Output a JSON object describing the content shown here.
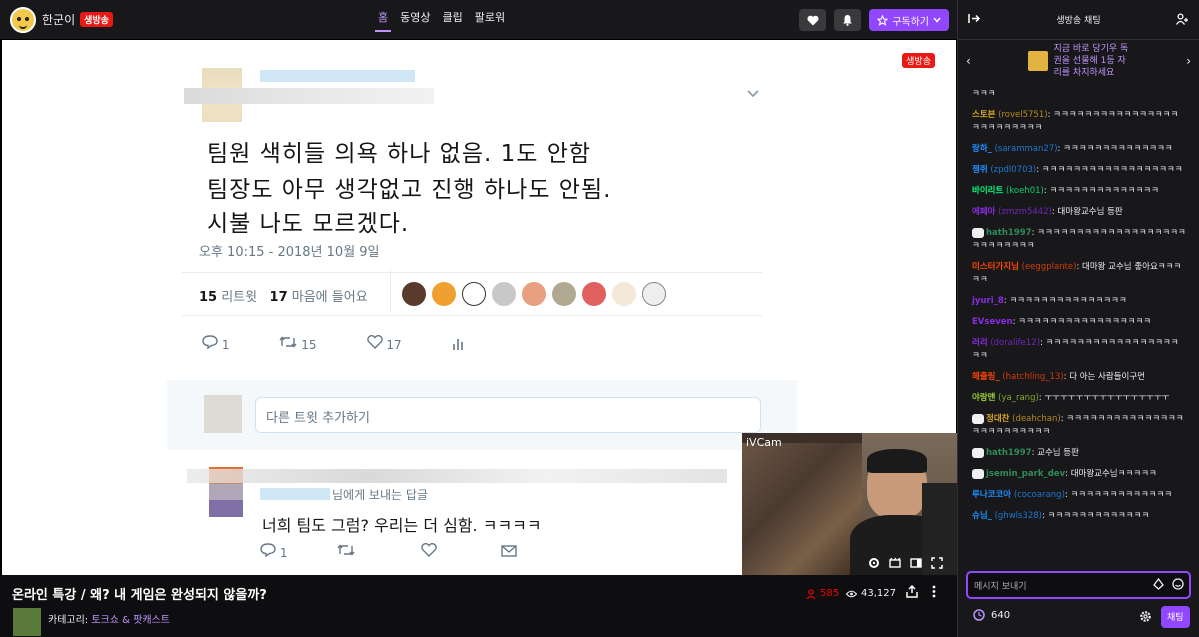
{
  "channel": {
    "name": "한군이",
    "live_label": "생방송"
  },
  "nav": {
    "tabs": [
      {
        "label": "홈",
        "active": true
      },
      {
        "label": "동영상",
        "active": false
      },
      {
        "label": "클립",
        "active": false
      },
      {
        "label": "팔로워",
        "active": false
      }
    ],
    "subscribe_label": "구독하기"
  },
  "video": {
    "live_label": "생방송",
    "tweet": {
      "line1": "팀원 색히들 의욕 하나 없음. 1도 안함",
      "line2": "팀장도 아무 생각없고 진행 하나도 안됨.",
      "line3": "시불 나도 모르겠다.",
      "date": "오후 10:15 - 2018년 10월 9일",
      "retweets_count": "15",
      "retweets_label": "리트윗",
      "likes_count": "17",
      "likes_label": "마음에 들어요",
      "reply_count": "1",
      "retweet_action_count": "15",
      "like_action_count": "17",
      "add_tweet_placeholder": "다른 트윗 추가하기",
      "reply_to_label": "님에게 보내는 답글",
      "reply_text": "너희 팀도 그럼? 우리는 더 심함. ㅋㅋㅋㅋ",
      "reply_reply_count": "1"
    },
    "cam_label": "iVCam"
  },
  "info": {
    "title": "온라인 특강 / 왜? 내 게임은 완성되지 않을까?",
    "category_prefix": "카테고리:",
    "category": "토크쇼 & 팟캐스트",
    "viewers": "585",
    "views": "43,127"
  },
  "chat": {
    "header": "생방송 채팅",
    "gift_text": "지금 바로 당기우 독권을 선물해 1등 자리를 차지하세요",
    "messages": [
      {
        "name": "",
        "id": "",
        "text": "ㅋㅋㅋ",
        "color": "#efeff1"
      },
      {
        "name": "스토븐",
        "id": "(rovel5751)",
        "text": ": ㅋㅋㅋㅋㅋㅋㅋㅋㅋㅋㅋㅋㅋㅋㅋㅋㅋㅋㅋㅋㅋㅋㅋㅋㅋ",
        "color": "#daa520"
      },
      {
        "name": "랑하_",
        "id": "(saramman27)",
        "text": ": ㅋㅋㅋㅋㅋㅋㅋㅋㅋㅋㅋㅋㅋㅋ",
        "color": "#1e90ff"
      },
      {
        "name": "젱쥐",
        "id": "(zpdl0703)",
        "text": ": ㅋㅋㅋㅋㅋㅋㅋㅋㅋㅋㅋㅋㅋㅋㅋㅋㅋㅋ",
        "color": "#1e90ff"
      },
      {
        "name": "바이리트",
        "id": "(koeh01)",
        "text": ": ㅋㅋㅋㅋㅋㅋㅋㅋㅋㅋㅋㅋㅋㅋ",
        "color": "#00ff7f"
      },
      {
        "name": "에페아",
        "id": "(zmzm5442)",
        "text": ": 대마왕교수님 등판",
        "color": "#8a2be2"
      },
      {
        "name": "hath1997",
        "id": "",
        "text": ": ㅋㅋㅋㅋㅋㅋㅋㅋㅋㅋㅋㅋㅋㅋㅋㅋㅋㅋㅋㅋㅋㅋㅋㅋㅋㅋㅋ",
        "color": "#2e8b57",
        "badges": true
      },
      {
        "name": "미스터가지님",
        "id": "(eeggplante)",
        "text": ": 대마왕 교수님 좋아요ㅋㅋㅋㅋㅋ",
        "color": "#ff4500"
      },
      {
        "name": "jyuri_8",
        "id": "",
        "text": ": ㅋㅋㅋㅋㅋㅋㅋㅋㅋㅋㅋㅋㅋㅋㅋ",
        "color": "#8a2be2"
      },
      {
        "name": "EVseven",
        "id": "",
        "text": ": ㅋㅋㅋㅋㅋㅋㅋㅋㅋㅋㅋㅋㅋㅋㅋㅋㅋ",
        "color": "#8a2be2"
      },
      {
        "name": "러리",
        "id": "(doralife12)",
        "text": ": ㅋㅋㅋㅋㅋㅋㅋㅋㅋㅋㅋㅋㅋㅋㅋㅋㅋㅋㅋ",
        "color": "#8a2be2"
      },
      {
        "name": "해출링_",
        "id": "(hatchling_13)",
        "text": ": 다 아는 사람들이구먼",
        "color": "#ff4500"
      },
      {
        "name": "야랑맨",
        "id": "(ya_rang)",
        "text": ": ㅜㅜㅜㅜㅜㅜㅜㅜㅜㅜㅜㅜㅜㅜㅜㅜ",
        "color": "#9acd32"
      },
      {
        "name": "정대찬",
        "id": "(deahchan)",
        "text": ": ㅋㅋㅋㅋㅋㅋㅋㅋㅋㅋㅋㅋㅋㅋㅋㅋㅋㅋㅋㅋㅋㅋㅋㅋㅋ",
        "color": "#daa520",
        "badges": true
      },
      {
        "name": "hath1997",
        "id": "",
        "text": ": 교수님 등판",
        "color": "#2e8b57",
        "badges": true
      },
      {
        "name": "jsemin_park_dev",
        "id": "",
        "text": ": 대마왕교수님ㅋㅋㅋㅋㅋ",
        "color": "#2e8b57",
        "badges": true
      },
      {
        "name": "루나코코아",
        "id": "(cocoarang)",
        "text": ": ㅋㅋㅋㅋㅋㅋㅋㅋㅋㅋㅋㅋㅋ",
        "color": "#1e90ff"
      },
      {
        "name": "슈님_",
        "id": "(ghwls328)",
        "text": ": ㅋㅋㅋㅋㅋㅋㅋㅋㅋㅋㅋㅋㅋ",
        "color": "#1e90ff"
      }
    ],
    "input_placeholder": "메시지 보내기",
    "points": "640",
    "send_label": "채팅"
  }
}
